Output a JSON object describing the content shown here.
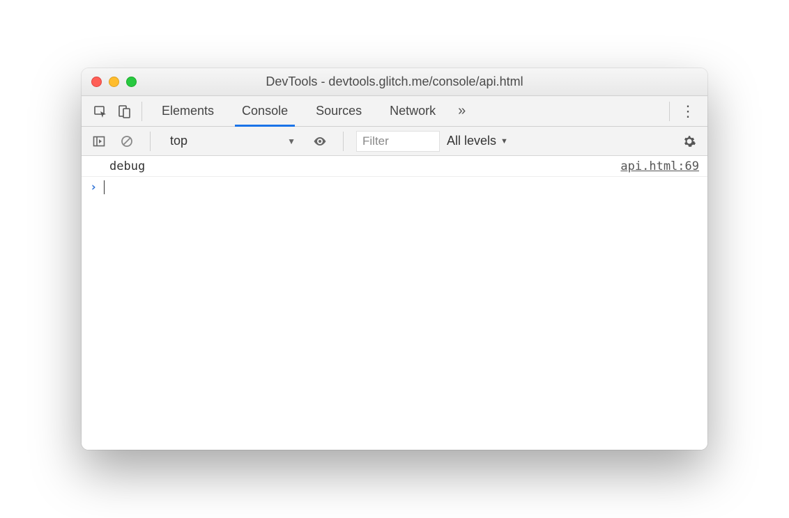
{
  "window": {
    "title": "DevTools - devtools.glitch.me/console/api.html"
  },
  "tabs": {
    "items": [
      "Elements",
      "Console",
      "Sources",
      "Network"
    ],
    "active_index": 1,
    "more_glyph": "»",
    "kebab_glyph": "⋮"
  },
  "toolbar": {
    "context": "top",
    "filter_placeholder": "Filter",
    "levels_label": "All levels"
  },
  "console": {
    "rows": [
      {
        "message": "debug",
        "source": "api.html:69"
      }
    ],
    "prompt_glyph": "›"
  }
}
